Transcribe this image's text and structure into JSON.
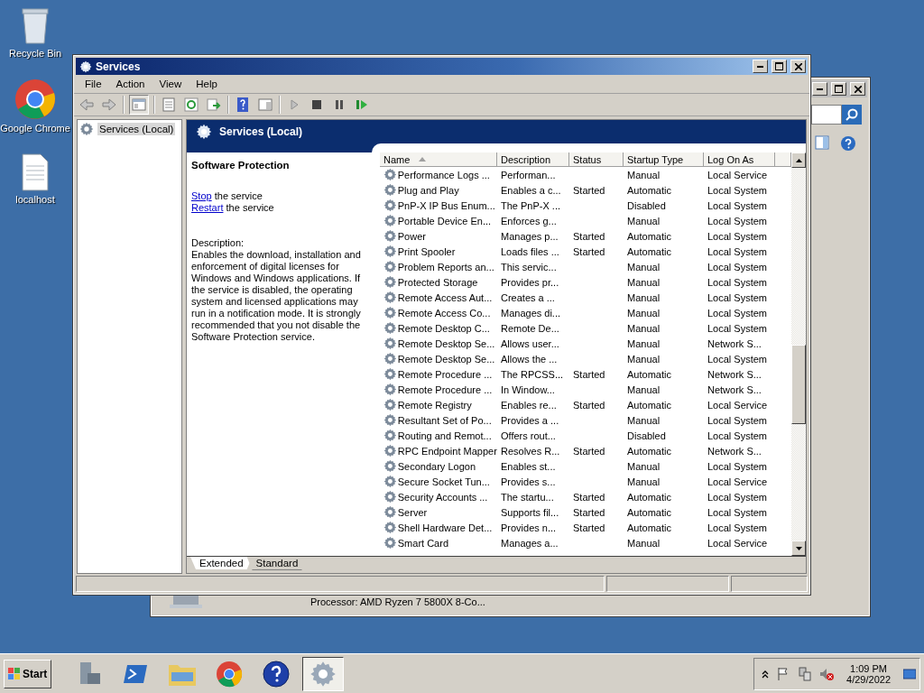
{
  "desktop_icons": [
    {
      "label": "Recycle Bin",
      "kind": "bin"
    },
    {
      "label": "Google Chrome",
      "kind": "browser"
    },
    {
      "label": "localhost",
      "kind": "file"
    }
  ],
  "background_window": {
    "processor_text": "Processor: AMD Ryzen 7 5800X 8-Co..."
  },
  "window": {
    "title": "Services",
    "menu": [
      "File",
      "Action",
      "View",
      "Help"
    ],
    "tree": [
      {
        "label": "Services (Local)",
        "selected": true
      }
    ],
    "header_title": "Services (Local)",
    "detail": {
      "service_name": "Software Protection",
      "actions": [
        {
          "link": "Stop",
          "text": "the service"
        },
        {
          "link": "Restart",
          "text": "the service"
        }
      ],
      "description_label": "Description:",
      "description": "Enables the download, installation and enforcement of digital licenses for Windows and Windows applications. If the service is disabled, the operating system and licensed applications may run in a notification mode. It is strongly recommended that you not disable the Software Protection service."
    },
    "table": {
      "columns": [
        {
          "label": "Name",
          "sorted": true
        },
        {
          "label": "Description",
          "sorted": false
        },
        {
          "label": "Status",
          "sorted": false
        },
        {
          "label": "Startup Type",
          "sorted": false
        },
        {
          "label": "Log On As",
          "sorted": false
        }
      ],
      "rows": [
        [
          "Performance Logs ...",
          "Performan...",
          "",
          "Manual",
          "Local Service"
        ],
        [
          "Plug and Play",
          "Enables a c...",
          "Started",
          "Automatic",
          "Local System"
        ],
        [
          "PnP-X IP Bus Enum...",
          "The PnP-X ...",
          "",
          "Disabled",
          "Local System"
        ],
        [
          "Portable Device En...",
          "Enforces g...",
          "",
          "Manual",
          "Local System"
        ],
        [
          "Power",
          "Manages p...",
          "Started",
          "Automatic",
          "Local System"
        ],
        [
          "Print Spooler",
          "Loads files ...",
          "Started",
          "Automatic",
          "Local System"
        ],
        [
          "Problem Reports an...",
          "This servic...",
          "",
          "Manual",
          "Local System"
        ],
        [
          "Protected Storage",
          "Provides pr...",
          "",
          "Manual",
          "Local System"
        ],
        [
          "Remote Access Aut...",
          "Creates a ...",
          "",
          "Manual",
          "Local System"
        ],
        [
          "Remote Access Co...",
          "Manages di...",
          "",
          "Manual",
          "Local System"
        ],
        [
          "Remote Desktop C...",
          "Remote De...",
          "",
          "Manual",
          "Local System"
        ],
        [
          "Remote Desktop Se...",
          "Allows user...",
          "",
          "Manual",
          "Network S..."
        ],
        [
          "Remote Desktop Se...",
          "Allows the ...",
          "",
          "Manual",
          "Local System"
        ],
        [
          "Remote Procedure ...",
          "The RPCSS...",
          "Started",
          "Automatic",
          "Network S..."
        ],
        [
          "Remote Procedure ...",
          "In Window...",
          "",
          "Manual",
          "Network S..."
        ],
        [
          "Remote Registry",
          "Enables re...",
          "Started",
          "Automatic",
          "Local Service"
        ],
        [
          "Resultant Set of Po...",
          "Provides a ...",
          "",
          "Manual",
          "Local System"
        ],
        [
          "Routing and Remot...",
          "Offers rout...",
          "",
          "Disabled",
          "Local System"
        ],
        [
          "RPC Endpoint Mapper",
          "Resolves R...",
          "Started",
          "Automatic",
          "Network S..."
        ],
        [
          "Secondary Logon",
          "Enables st...",
          "",
          "Manual",
          "Local System"
        ],
        [
          "Secure Socket Tun...",
          "Provides s...",
          "",
          "Manual",
          "Local Service"
        ],
        [
          "Security Accounts ...",
          "The startu...",
          "Started",
          "Automatic",
          "Local System"
        ],
        [
          "Server",
          "Supports fil...",
          "Started",
          "Automatic",
          "Local System"
        ],
        [
          "Shell Hardware Det...",
          "Provides n...",
          "Started",
          "Automatic",
          "Local System"
        ],
        [
          "Smart Card",
          "Manages a...",
          "",
          "Manual",
          "Local Service"
        ]
      ]
    },
    "tabs": [
      {
        "label": "Extended",
        "selected": true
      },
      {
        "label": "Standard",
        "selected": false
      }
    ]
  },
  "taskbar": {
    "start_label": "Start",
    "apps": [
      {
        "kind": "server",
        "active": false
      },
      {
        "kind": "shell",
        "active": false
      },
      {
        "kind": "folder",
        "active": false
      },
      {
        "kind": "browser",
        "active": false
      },
      {
        "kind": "help",
        "active": false
      },
      {
        "kind": "gears",
        "active": true
      }
    ],
    "time": "1:09 PM",
    "date": "4/29/2022"
  }
}
